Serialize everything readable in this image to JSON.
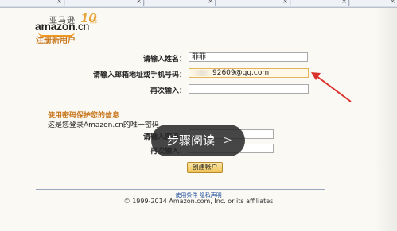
{
  "logo": {
    "cn_name": "亚马逊",
    "wordmark": "amazon",
    "wordmark_suffix": ".cn",
    "anniversary": "10",
    "anniversary_sub": "周年"
  },
  "page": {
    "section_title": "注册新用户"
  },
  "form": {
    "name_label": "请输入姓名：",
    "name_value": "菲菲",
    "email_label": "请输入邮箱地址或手机号码：",
    "email_value": "92609@qq.com",
    "confirm_label": "再次输入：",
    "confirm_value": ""
  },
  "password": {
    "title": "使用密码保护您的信息",
    "subtitle": "这是您登录Amazon.cn的唯一密码",
    "password_label": "请输入密码：",
    "password_value": "",
    "repeat_label": "再次输入：",
    "repeat_value": ""
  },
  "overlay": {
    "text": "步骤阅读",
    "chevron": ">"
  },
  "buttons": {
    "create_account": "创建帐户"
  },
  "footer": {
    "terms": "使用条件",
    "privacy": "隐私声明",
    "copyright": "© 1999-2014 Amazon.com, Inc. or its affiliates"
  },
  "colors": {
    "accent_orange": "#c8751a",
    "arrow_red": "#d9322c",
    "link_blue": "#1a4a9b"
  },
  "icons": {
    "overlay_chevron": "chevron-right-icon",
    "tab_close": "close-icon"
  }
}
